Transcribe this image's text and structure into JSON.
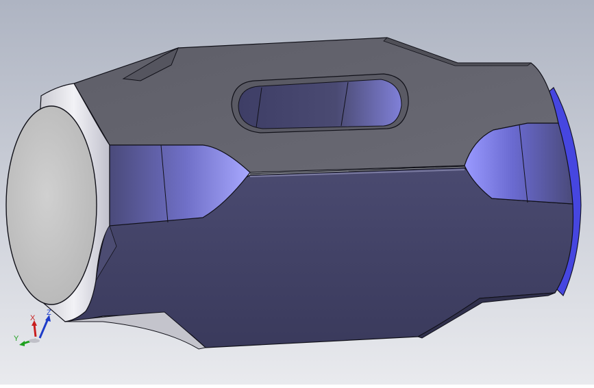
{
  "viewport": {
    "background_top": "#aeb4c2",
    "background_bottom": "#e9eaee"
  },
  "model": {
    "name": "",
    "colors": {
      "body_dark": "#404064",
      "body_mid": "#52527a",
      "top_face": "#62626c",
      "top_face_dark": "#55555f",
      "end_face": "#c9c9c9",
      "chamfer": "#dcdce4",
      "highlight": "#8a8aff",
      "edge": "#101018",
      "blue_rim": "#4a4ae6"
    }
  },
  "triad": {
    "x_label": "X",
    "y_label": "Y",
    "z_label": "Z",
    "x_color": "#c81e1e",
    "y_color": "#1ea01e",
    "z_color": "#1e3cc8"
  }
}
